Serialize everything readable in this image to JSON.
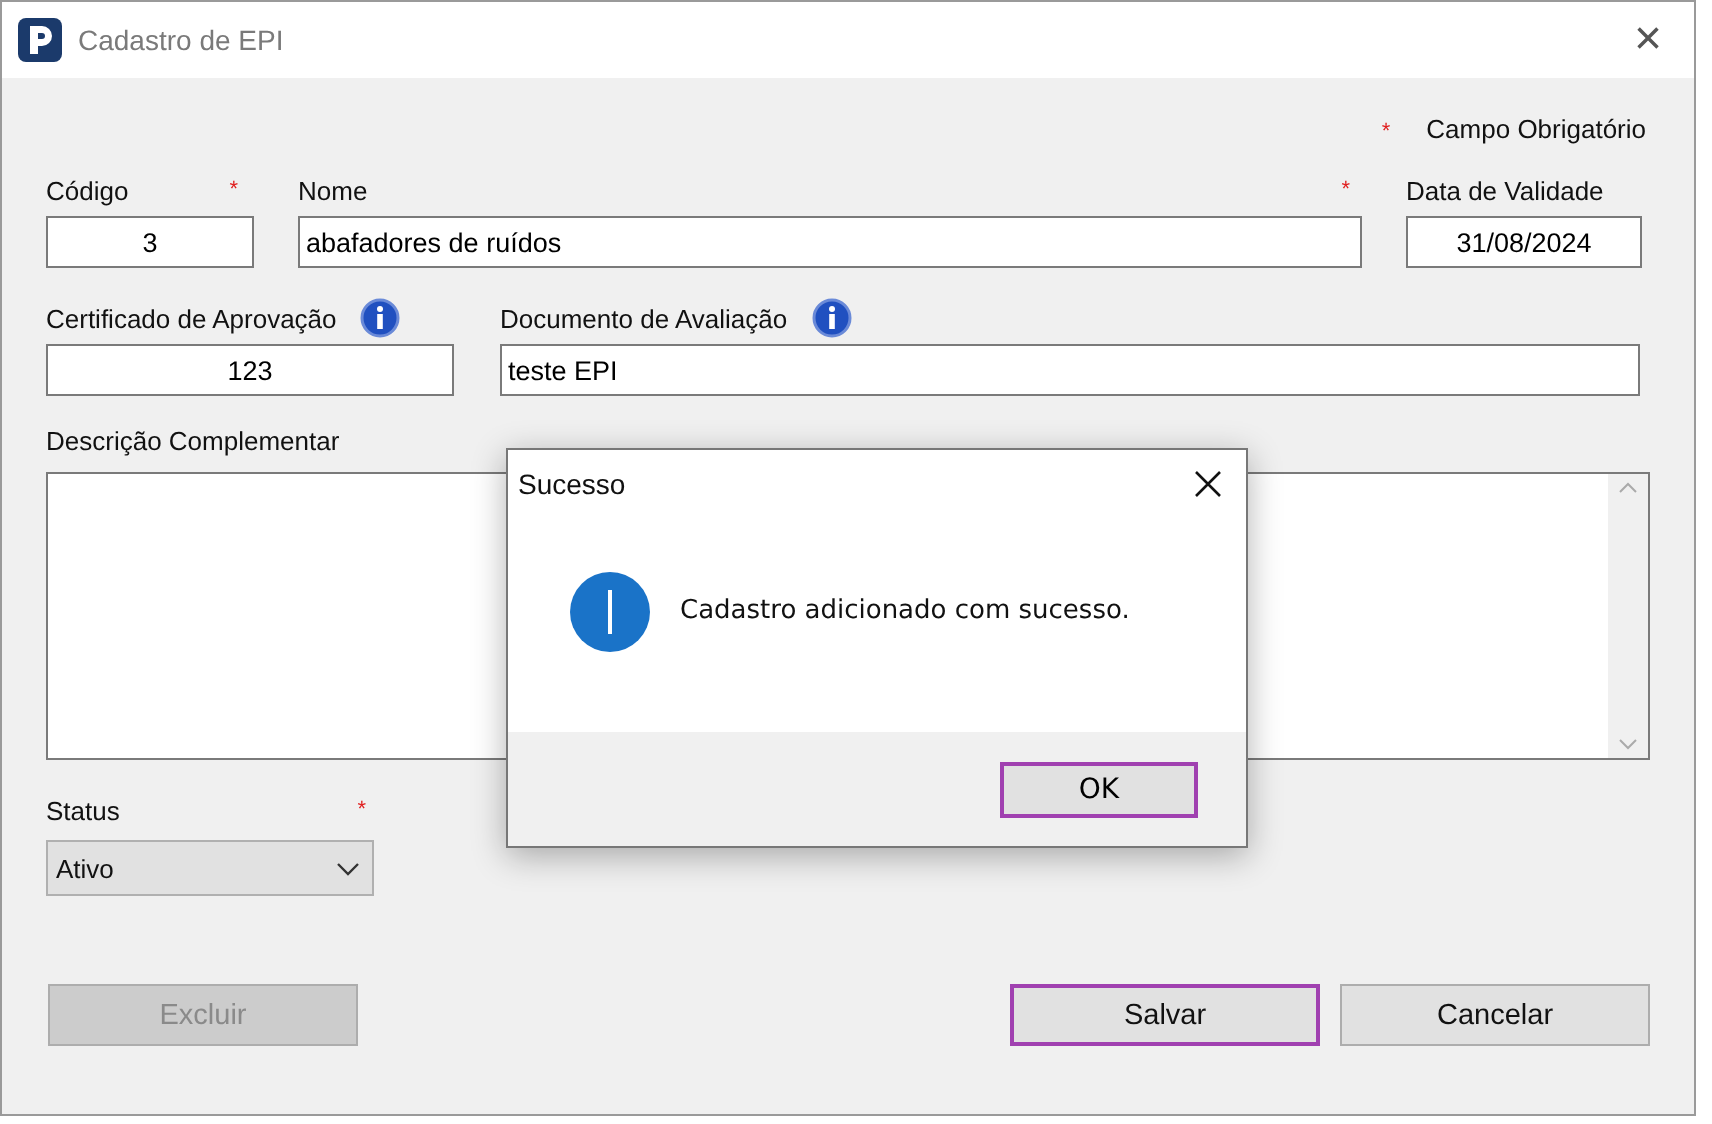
{
  "window": {
    "title": "Cadastro de EPI",
    "close": "×"
  },
  "legend": {
    "mark": "*",
    "text": "Campo Obrigatório"
  },
  "fields": [
    {
      "label": "Código",
      "value": "3",
      "required": true,
      "info": false
    },
    {
      "label": "Nome",
      "value": "abafadores de ruídos",
      "required": true,
      "info": false
    },
    {
      "label": "Data de Validade",
      "value": "31/08/2024",
      "required": false,
      "info": false
    },
    {
      "label": "Certificado de Aprovação",
      "value": "123",
      "required": false,
      "info": true
    },
    {
      "label": "Documento de Avaliação",
      "value": "teste EPI",
      "required": false,
      "info": true
    }
  ],
  "description": {
    "label": "Descrição Complementar"
  },
  "status": {
    "label": "Status",
    "value": "Ativo",
    "required": true
  },
  "buttons": [
    {
      "label": "Excluir",
      "disabled": true,
      "focused": false
    },
    {
      "label": "Salvar",
      "disabled": false,
      "focused": true
    },
    {
      "label": "Cancelar",
      "disabled": false,
      "focused": false
    }
  ],
  "dialog": {
    "title": "Sucesso",
    "message": "Cadastro adicionado com sucesso.",
    "button": {
      "label": "OK",
      "focused": true
    }
  }
}
